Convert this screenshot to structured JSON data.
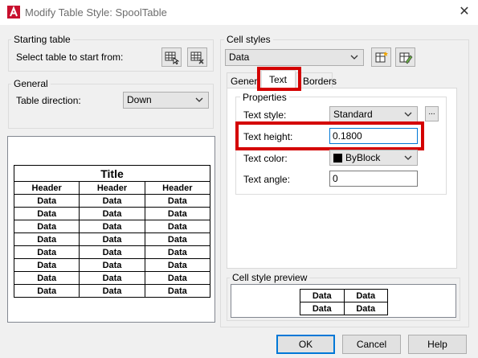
{
  "window": {
    "title": "Modify Table Style: SpoolTable"
  },
  "starting_table": {
    "group_label": "Starting table",
    "select_label": "Select table to start from:"
  },
  "general": {
    "group_label": "General",
    "direction_label": "Table direction:",
    "direction_value": "Down"
  },
  "table_preview": {
    "title": "Title",
    "headers": [
      "Header",
      "Header",
      "Header"
    ],
    "cell": "Data",
    "rows": 8
  },
  "cell_styles": {
    "group_label": "Cell styles",
    "selected": "Data",
    "tabs": [
      "General",
      "Text",
      "Borders"
    ],
    "active_tab": "Text"
  },
  "properties": {
    "group_label": "Properties",
    "text_style_label": "Text style:",
    "text_style_value": "Standard",
    "browse_label": "...",
    "text_height_label": "Text height:",
    "text_height_value": "0.1800",
    "text_color_label": "Text color:",
    "text_color_value": "ByBlock",
    "text_angle_label": "Text angle:",
    "text_angle_value": "0"
  },
  "cell_style_preview": {
    "group_label": "Cell style preview",
    "cells": [
      "Data",
      "Data",
      "Data",
      "Data"
    ]
  },
  "buttons": {
    "ok": "OK",
    "cancel": "Cancel",
    "help": "Help"
  },
  "colors": {
    "highlight": "#d40000",
    "app_icon": "#c8102e",
    "default_button": "#0078d7"
  }
}
